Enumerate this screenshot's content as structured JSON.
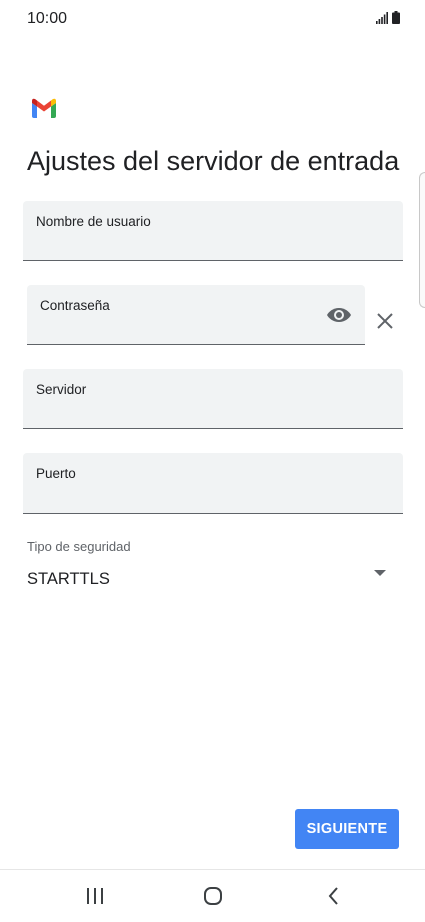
{
  "status_bar": {
    "time": "10:00",
    "icons": [
      "signal-icon",
      "battery-icon"
    ]
  },
  "app": {
    "logo": "gmail-logo-icon",
    "title": "Ajustes del servidor de entrada"
  },
  "fields": {
    "username": {
      "label": "Nombre de usuario",
      "value": ""
    },
    "password": {
      "label": "Contraseña",
      "value": ""
    },
    "server": {
      "label": "Servidor",
      "value": ""
    },
    "port": {
      "label": "Puerto",
      "value": ""
    }
  },
  "security": {
    "label": "Tipo de seguridad",
    "value": "STARTTLS"
  },
  "next_button": {
    "label": "SIGUIENTE"
  },
  "nav_bar": {
    "items": [
      "recents-icon",
      "home-icon",
      "back-icon"
    ]
  },
  "colors": {
    "accent": "#4285f4",
    "field_bg": "#f1f3f4",
    "text": "#202124"
  }
}
